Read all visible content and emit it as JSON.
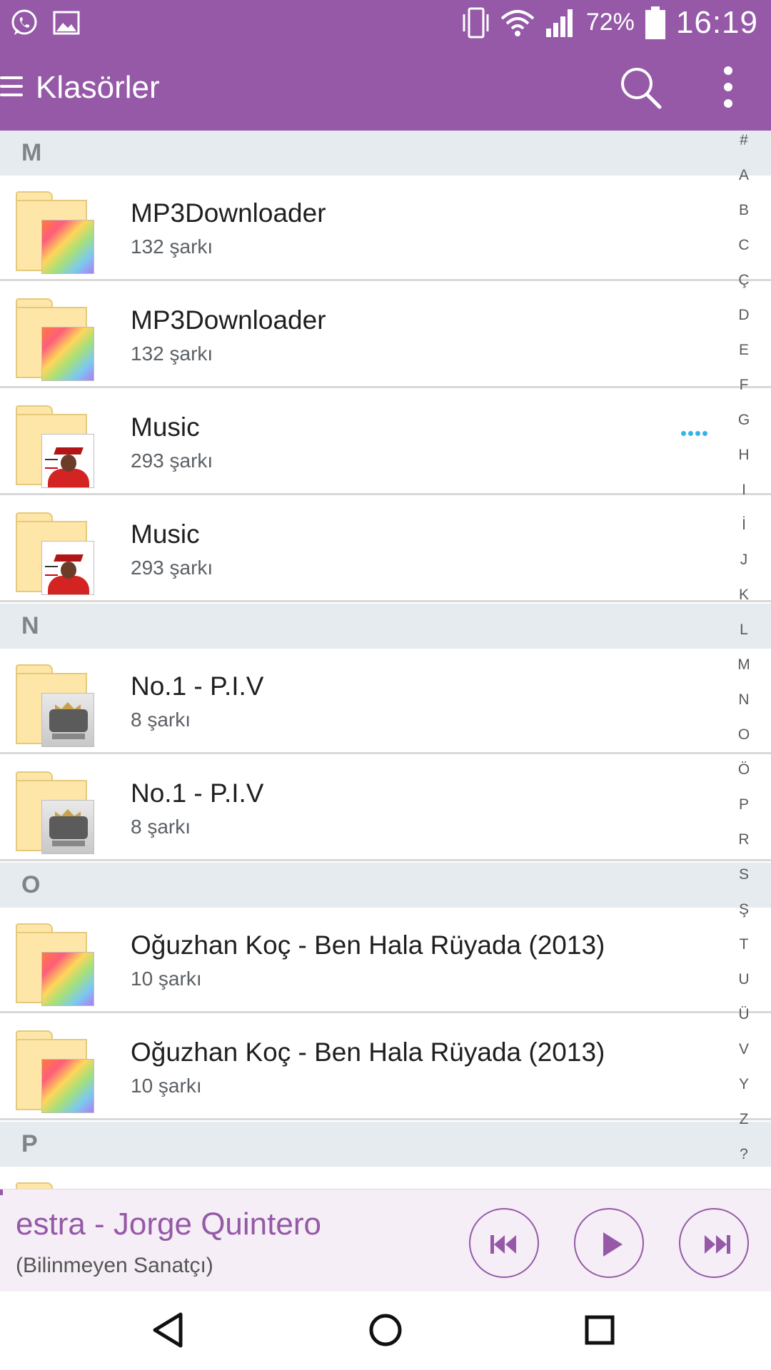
{
  "status_bar": {
    "battery_percent": "72%",
    "time": "16:19",
    "left_icons": [
      "whatsapp-icon",
      "image-icon"
    ],
    "right_icons": [
      "vibrate-icon",
      "wifi-icon",
      "signal-icon",
      "battery-icon"
    ]
  },
  "app_bar": {
    "title": "Klasörler",
    "icons": [
      "menu-icon",
      "search-icon",
      "more-vert-icon"
    ]
  },
  "sections": [
    {
      "letter": "M",
      "items": [
        {
          "title": "MP3Downloader",
          "subtitle": "132 şarkı",
          "art": "rainbow"
        },
        {
          "title": "MP3Downloader",
          "subtitle": "132 şarkı",
          "art": "rainbow"
        },
        {
          "title": "Music",
          "subtitle": "293 şarkı",
          "art": "music",
          "more": true
        },
        {
          "title": "Music",
          "subtitle": "293 şarkı",
          "art": "music"
        }
      ]
    },
    {
      "letter": "N",
      "items": [
        {
          "title": "No.1 - P.I.V",
          "subtitle": "8 şarkı",
          "art": "piv"
        },
        {
          "title": "No.1 - P.I.V",
          "subtitle": "8 şarkı",
          "art": "piv"
        }
      ]
    },
    {
      "letter": "O",
      "items": [
        {
          "title": "Oğuzhan Koç - Ben Hala Rüyada (2013)",
          "subtitle": "10 şarkı",
          "art": "rainbow"
        },
        {
          "title": "Oğuzhan Koç - Ben Hala Rüyada (2013)",
          "subtitle": "10 şarkı",
          "art": "rainbow"
        }
      ]
    },
    {
      "letter": "P",
      "items": []
    }
  ],
  "alphabet_index": [
    "#",
    "A",
    "B",
    "C",
    "Ç",
    "D",
    "E",
    "F",
    "G",
    "H",
    "I",
    "İ",
    "J",
    "K",
    "L",
    "M",
    "N",
    "O",
    "Ö",
    "P",
    "R",
    "S",
    "Ş",
    "T",
    "U",
    "Ü",
    "V",
    "Y",
    "Z",
    "?"
  ],
  "player": {
    "track": "estra - Jorge Quintero",
    "artist": "(Bilinmeyen Sanatçı)",
    "controls": [
      "previous-icon",
      "play-icon",
      "next-icon"
    ]
  },
  "nav_bar": {
    "buttons": [
      "back-icon",
      "home-icon",
      "recents-icon"
    ]
  },
  "colors": {
    "accent": "#9559a7",
    "section_bg": "#e5ebef",
    "more_dots": "#33b5e5"
  }
}
